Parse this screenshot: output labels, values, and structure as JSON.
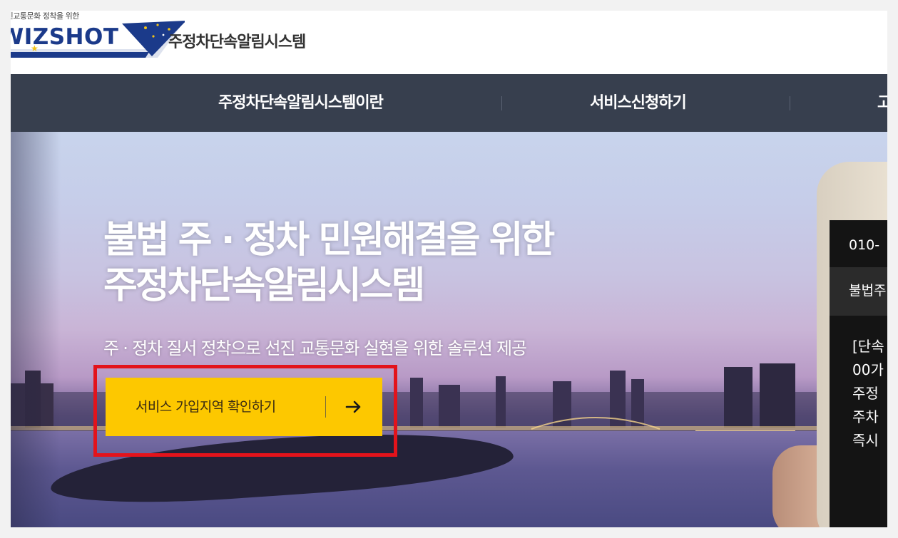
{
  "header": {
    "logo_tagline": "선진교통문화 정착을 위한",
    "logo_text": "WIZSHOT",
    "system_name": "주정차단속알림시스템"
  },
  "nav": {
    "items": [
      {
        "label": "주정차단속알림시스템이란"
      },
      {
        "label": "서비스신청하기"
      },
      {
        "label": "고"
      }
    ],
    "background": "#373f4e"
  },
  "hero": {
    "title_line1": "불법 주 · 정차 민원해결을 위한",
    "title_line2": "주정차단속알림시스템",
    "subtitle": "주 · 정차 질서 정착으로 선진 교통문화 실현을 위한 솔루션 제공",
    "cta_label": "서비스 가입지역 확인하기",
    "cta_color": "#fdc800",
    "highlight_color": "#e3131b"
  },
  "phone": {
    "number": "010-",
    "bar_text": "불법주",
    "message_lines": [
      "[단속",
      "00가",
      "주정",
      "주차",
      "즉시"
    ]
  },
  "icons": [
    "star-icon",
    "arrow-right-icon"
  ]
}
